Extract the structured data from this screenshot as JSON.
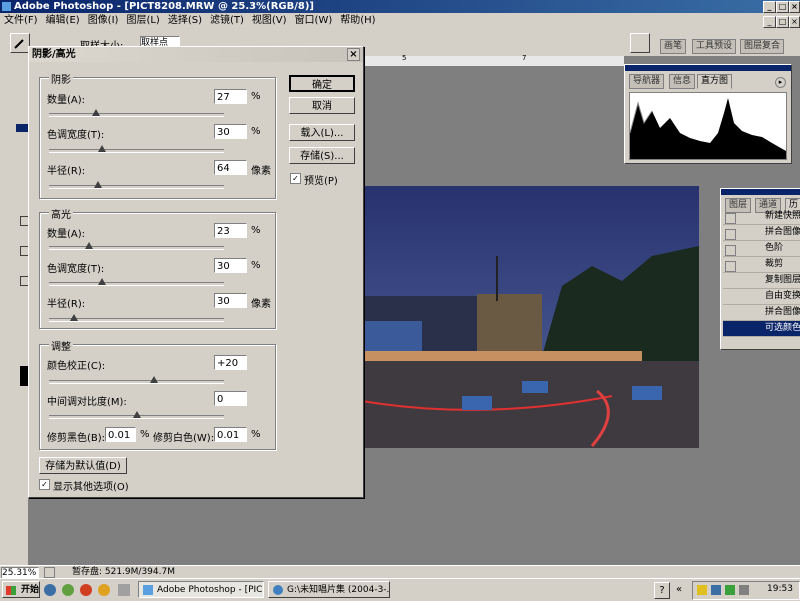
{
  "app": {
    "title": "Adobe Photoshop - [PICT8208.MRW @ 25.3%(RGB/8)]",
    "menu": [
      "文件(F)",
      "编辑(E)",
      "图像(I)",
      "图层(L)",
      "选择(S)",
      "滤镜(T)",
      "视图(V)",
      "窗口(W)",
      "帮助(H)"
    ],
    "sample_size_label": "取样大小:",
    "sample_size_value": "取样点",
    "dock_tabs": [
      "画笔",
      "工具预设",
      "图层复合"
    ]
  },
  "dialog": {
    "title": "阴影/高光",
    "shadows": {
      "label": "阴影",
      "amount_label": "数量(A):",
      "amount": "27",
      "amount_unit": "%",
      "tonal_label": "色调宽度(T):",
      "tonal": "30",
      "tonal_unit": "%",
      "radius_label": "半径(R):",
      "radius": "64",
      "radius_unit": "像素"
    },
    "highlights": {
      "label": "高光",
      "amount_label": "数量(A):",
      "amount": "23",
      "amount_unit": "%",
      "tonal_label": "色调宽度(T):",
      "tonal": "30",
      "tonal_unit": "%",
      "radius_label": "半径(R):",
      "radius": "30",
      "radius_unit": "像素"
    },
    "adjust": {
      "label": "调整",
      "color_label": "颜色校正(C):",
      "color": "+20",
      "midtone_label": "中间调对比度(M):",
      "midtone": "0",
      "clip_black_label": "修剪黑色(B):",
      "clip_black": "0.01",
      "clip_black_unit": "%",
      "clip_white_label": "修剪白色(W):",
      "clip_white": "0.01",
      "clip_white_unit": "%"
    },
    "slider_levels": {
      "shadow_amount": 0.27,
      "shadow_tonal": 0.3,
      "shadow_radius": 0.28,
      "highlight_amount": 0.23,
      "highlight_tonal": 0.3,
      "highlight_radius": 0.14,
      "color": 0.6,
      "midtone": 0.5
    },
    "buttons": {
      "ok": "确定",
      "cancel": "取消",
      "load": "载入(L)...",
      "save": "存储(S)...",
      "save_default": "存储为默认值(D)"
    },
    "preview_label": "预览(P)",
    "show_more_label": "显示其他选项(O)"
  },
  "navigator": {
    "tabs": [
      "导航器",
      "信息",
      "直方图"
    ]
  },
  "layers": {
    "tabs": [
      "图层",
      "通道",
      "历"
    ],
    "history": [
      "新建快照",
      "拼合图像",
      "色阶",
      "裁剪",
      "复制图层",
      "自由变换",
      "拼合图像",
      "可选颜色"
    ]
  },
  "status": {
    "zoom": "25.31%",
    "scratch": "暂存盘: 521.9M/394.7M"
  },
  "taskbar": {
    "start": "开始",
    "tasks": [
      "Adobe Photoshop - [PIC...",
      "G:\\未知唱片集 (2004-3-..."
    ],
    "clock": "19:53"
  },
  "colors": {
    "titlebar": "#0a246a",
    "face": "#d4d0c8",
    "workspace": "#7f7f7f"
  }
}
